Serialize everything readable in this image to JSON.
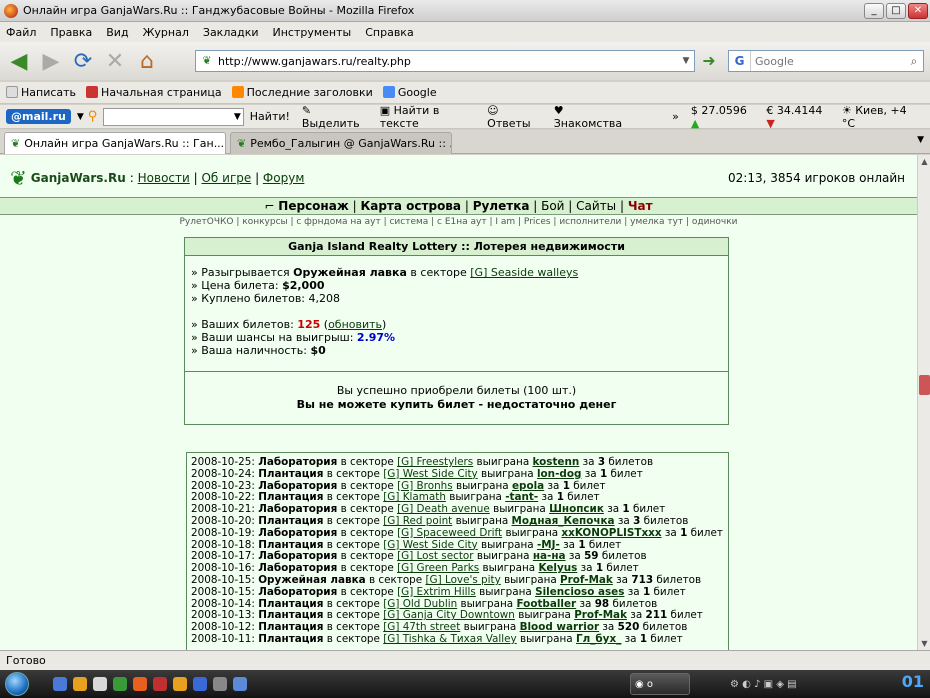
{
  "window": {
    "title": "Онлайн игра GanjaWars.Ru :: Ганджубасовые Войны - Mozilla Firefox"
  },
  "menu": [
    "Файл",
    "Правка",
    "Вид",
    "Журнал",
    "Закладки",
    "Инструменты",
    "Справка"
  ],
  "url": "http://www.ganjawars.ru/realty.php",
  "search": {
    "placeholder": "Google"
  },
  "bookmarks": [
    "Написать",
    "Начальная страница",
    "Последние заголовки",
    "Google"
  ],
  "mailbar": {
    "logo": "@mail.ru",
    "find_btn": "Найти!",
    "items": [
      "Выделить",
      "Найти в тексте",
      "Ответы",
      "Знакомства"
    ],
    "usd": "$ 27.0596",
    "eur": "€ 34.4144",
    "weather": "Киев, +4 °C"
  },
  "tabs": [
    "Онлайн игра GanjaWars.Ru :: Ган...",
    "Рембо_Галыгин @ GanjaWars.Ru :: ..."
  ],
  "site": {
    "name": "GanjaWars.Ru",
    "links": [
      "Новости",
      "Об игре",
      "Форум"
    ],
    "online": "02:13, 3854 игроков онлайн",
    "nav": [
      "Персонаж",
      "Карта острова",
      "Рулетка",
      "Бой",
      "Сайты",
      "Чат"
    ],
    "subnav": "РулетОЧКО | конкурсы | с фрндома на аут | система | с Е1на аут | I am | Prices | исполнители | умелка тут | одиночки"
  },
  "lottery": {
    "title": "Ganja Island Realty Lottery :: Лотерея недвижимости",
    "raffle_prefix": "» Разыгрывается",
    "raffle_item": "Оружейная лавка",
    "raffle_mid": "в секторе",
    "raffle_sector": "[G] Seaside walleys",
    "price_label": "» Цена билета:",
    "price": "$2,000",
    "bought_label": "» Куплено билетов:",
    "bought": "4,208",
    "yours_label": "» Ваших билетов:",
    "yours": "125",
    "refresh": "обновить",
    "chance_label": "» Ваши шансы на выигрыш:",
    "chance": "2.97%",
    "cash_label": "» Ваша наличность:",
    "cash": "$0",
    "msg_ok": "Вы успешно приобрели билеты (100 шт.)",
    "msg_err": "Вы не можете купить билет - недостаточно денег"
  },
  "history": [
    {
      "date": "2008-10-25:",
      "type": "Лаборатория",
      "sector": "[G] Freestylers",
      "winner": "kostenn",
      "count": "3",
      "unit": "билетов"
    },
    {
      "date": "2008-10-24:",
      "type": "Плантация",
      "sector": "[G] West Side City",
      "winner": "lon-dog",
      "count": "1",
      "unit": "билет"
    },
    {
      "date": "2008-10-23:",
      "type": "Лаборатория",
      "sector": "[G] Bronhs",
      "winner": "epola",
      "count": "1",
      "unit": "билет"
    },
    {
      "date": "2008-10-22:",
      "type": "Плантация",
      "sector": "[G] Klamath",
      "winner": "-tant-",
      "count": "1",
      "unit": "билет"
    },
    {
      "date": "2008-10-21:",
      "type": "Лаборатория",
      "sector": "[G] Death avenue",
      "winner": "Шнопсик",
      "count": "1",
      "unit": "билет"
    },
    {
      "date": "2008-10-20:",
      "type": "Плантация",
      "sector": "[G] Red point",
      "winner": "Модная_Кепочка",
      "count": "3",
      "unit": "билетов"
    },
    {
      "date": "2008-10-19:",
      "type": "Лаборатория",
      "sector": "[G] Spaceweed Drift",
      "winner": "xxKONOPLISTxxx",
      "count": "1",
      "unit": "билет"
    },
    {
      "date": "2008-10-18:",
      "type": "Плантация",
      "sector": "[G] West Side City",
      "winner": "-MJ-",
      "count": "1",
      "unit": "билет"
    },
    {
      "date": "2008-10-17:",
      "type": "Лаборатория",
      "sector": "[G] Lost sector",
      "winner": "на-на",
      "count": "59",
      "unit": "билетов"
    },
    {
      "date": "2008-10-16:",
      "type": "Лаборатория",
      "sector": "[G] Green Parks",
      "winner": "Kelyus",
      "count": "1",
      "unit": "билет"
    },
    {
      "date": "2008-10-15:",
      "type": "Оружейная лавка",
      "sector": "[G] Love's pity",
      "winner": "Prof-Mak",
      "count": "713",
      "unit": "билетов"
    },
    {
      "date": "2008-10-15:",
      "type": "Лаборатория",
      "sector": "[G] Extrim Hills",
      "winner": "Silencioso ases",
      "count": "1",
      "unit": "билет"
    },
    {
      "date": "2008-10-14:",
      "type": "Плантация",
      "sector": "[G] Old Dublin",
      "winner": "Footballer",
      "count": "98",
      "unit": "билетов"
    },
    {
      "date": "2008-10-13:",
      "type": "Плантация",
      "sector": "[G] Ganja City Downtown",
      "winner": "Prof-Mak",
      "count": "211",
      "unit": "билет"
    },
    {
      "date": "2008-10-12:",
      "type": "Плантация",
      "sector": "[G] 47th street",
      "winner": "Blood warrior",
      "count": "520",
      "unit": "билетов"
    },
    {
      "date": "2008-10-11:",
      "type": "Плантация",
      "sector": "[G] Tishka & Тихая Valley",
      "winner": "Гл_бух_",
      "count": "1",
      "unit": "билет"
    }
  ],
  "history_words": {
    "in": "в секторе",
    "won": "выиграна",
    "for": "за"
  },
  "status": "Готово",
  "clock": "01"
}
